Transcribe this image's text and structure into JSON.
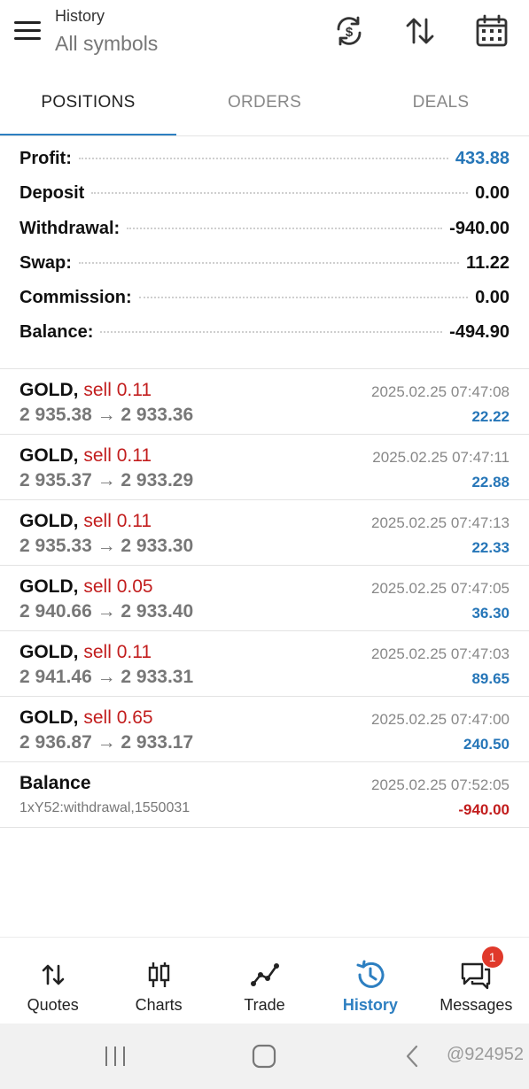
{
  "header": {
    "title": "History",
    "subtitle": "All symbols",
    "icons": [
      "menu-icon",
      "currency-exchange-icon",
      "sort-icon",
      "calendar-icon"
    ]
  },
  "tabs": [
    {
      "label": "POSITIONS",
      "active": true
    },
    {
      "label": "ORDERS",
      "active": false
    },
    {
      "label": "DEALS",
      "active": false
    }
  ],
  "summary": [
    {
      "label": "Profit:",
      "value": "433.88",
      "highlight": true
    },
    {
      "label": "Deposit",
      "value": "0.00",
      "highlight": false
    },
    {
      "label": "Withdrawal:",
      "value": "-940.00",
      "highlight": false
    },
    {
      "label": "Swap:",
      "value": "11.22",
      "highlight": false
    },
    {
      "label": "Commission:",
      "value": "0.00",
      "highlight": false
    },
    {
      "label": "Balance:",
      "value": "-494.90",
      "highlight": false
    }
  ],
  "deals": [
    {
      "symbol": "GOLD,",
      "side": "sell 0.11",
      "prices": "2 935.38 → 2 933.36",
      "time": "2025.02.25 07:47:08",
      "profit": "22.22"
    },
    {
      "symbol": "GOLD,",
      "side": "sell 0.11",
      "prices": "2 935.37 → 2 933.29",
      "time": "2025.02.25 07:47:11",
      "profit": "22.88"
    },
    {
      "symbol": "GOLD,",
      "side": "sell 0.11",
      "prices": "2 935.33 → 2 933.30",
      "time": "2025.02.25 07:47:13",
      "profit": "22.33"
    },
    {
      "symbol": "GOLD,",
      "side": "sell 0.05",
      "prices": "2 940.66 → 2 933.40",
      "time": "2025.02.25 07:47:05",
      "profit": "36.30"
    },
    {
      "symbol": "GOLD,",
      "side": "sell 0.11",
      "prices": "2 941.46 → 2 933.31",
      "time": "2025.02.25 07:47:03",
      "profit": "89.65"
    },
    {
      "symbol": "GOLD,",
      "side": "sell 0.65",
      "prices": "2 936.87 → 2 933.17",
      "time": "2025.02.25 07:47:00",
      "profit": "240.50"
    }
  ],
  "balance_entry": {
    "title": "Balance",
    "comment": "1xY52:withdrawal,1550031",
    "time": "2025.02.25 07:52:05",
    "amount": "-940.00"
  },
  "bottom_nav": [
    {
      "label": "Quotes",
      "icon": "arrows-updown-icon",
      "active": false
    },
    {
      "label": "Charts",
      "icon": "candlestick-icon",
      "active": false
    },
    {
      "label": "Trade",
      "icon": "trend-line-icon",
      "active": false
    },
    {
      "label": "History",
      "icon": "history-icon",
      "active": true
    },
    {
      "label": "Messages",
      "icon": "chat-icon",
      "active": false,
      "badge": "1"
    }
  ],
  "system_bar": {
    "watermark": "@924952"
  },
  "colors": {
    "accent": "#2d7fc1",
    "profit_blue": "#2676b8",
    "sell_red": "#c21d1d"
  }
}
